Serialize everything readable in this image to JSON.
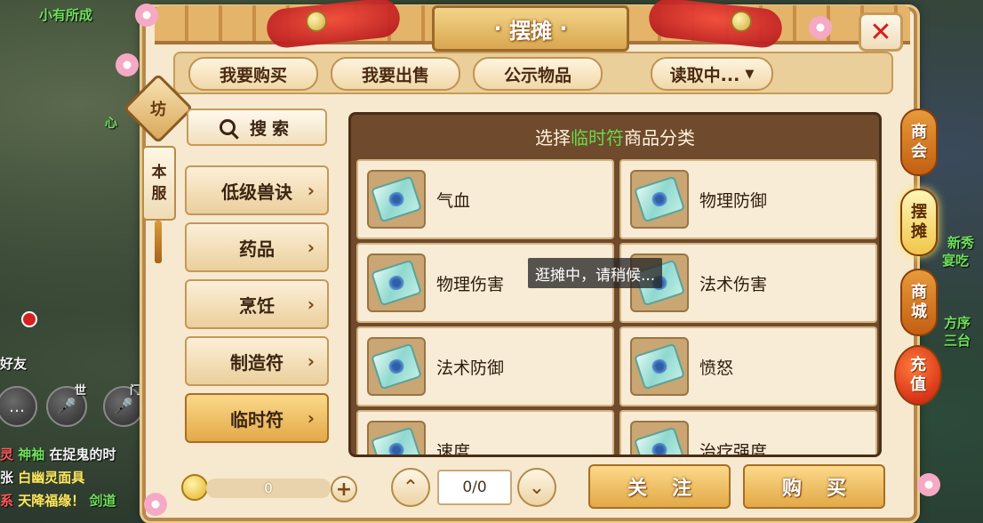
{
  "background": {
    "top_left_name": "小有所成",
    "chat_lines": [
      {
        "prefix": "灵",
        "name": "神袖",
        "text": "在捉鬼的时"
      },
      {
        "prefix": "张",
        "name": "白幽灵面具",
        "text": ""
      },
      {
        "prefix": "系",
        "name": "天降福缘！",
        "text": "剑道"
      }
    ],
    "left_labels": [
      "心",
      "好友",
      "世",
      "门"
    ],
    "right_labels": [
      "新秀",
      "宴吃",
      "方序",
      "三台"
    ]
  },
  "window": {
    "title": "摆摊",
    "close_icon": "close-icon"
  },
  "top_tabs": [
    {
      "label": "我要购买"
    },
    {
      "label": "我要出售"
    },
    {
      "label": "公示物品"
    },
    {
      "label": "读取中...",
      "icon": "dropdown-triangle-icon"
    }
  ],
  "badges": {
    "fang": "坊",
    "benfu": [
      "本",
      "服"
    ]
  },
  "search": {
    "label": "搜索",
    "icon": "search-icon"
  },
  "categories": [
    {
      "label": "低级兽诀"
    },
    {
      "label": "药品"
    },
    {
      "label": "烹饪"
    },
    {
      "label": "制造符"
    },
    {
      "label": "临时符",
      "active": true
    }
  ],
  "grid": {
    "header_prefix": "选择",
    "header_highlight": "临时符",
    "header_suffix": "商品分类",
    "items": [
      {
        "name": "气血"
      },
      {
        "name": "物理防御"
      },
      {
        "name": "物理伤害"
      },
      {
        "name": "法术伤害"
      },
      {
        "name": "法术防御"
      },
      {
        "name": "愤怒"
      },
      {
        "name": "速度"
      },
      {
        "name": "治疗强度"
      }
    ]
  },
  "toast": "逛摊中，请稍候...",
  "footer": {
    "coin_value": "0",
    "page": "0/0",
    "follow_label": "关注",
    "buy_label": "购买"
  },
  "side_tabs": [
    {
      "label": [
        "商",
        "会"
      ]
    },
    {
      "label": [
        "摆",
        "摊"
      ],
      "active": true
    },
    {
      "label": [
        "商",
        "城"
      ]
    },
    {
      "label": [
        "充",
        "值"
      ]
    }
  ],
  "colors": {
    "highlight_green": "#6ad84a",
    "panel_bg": "#f7e9cf",
    "active_orange": "#e3a948",
    "close_red": "#d81c1c"
  }
}
